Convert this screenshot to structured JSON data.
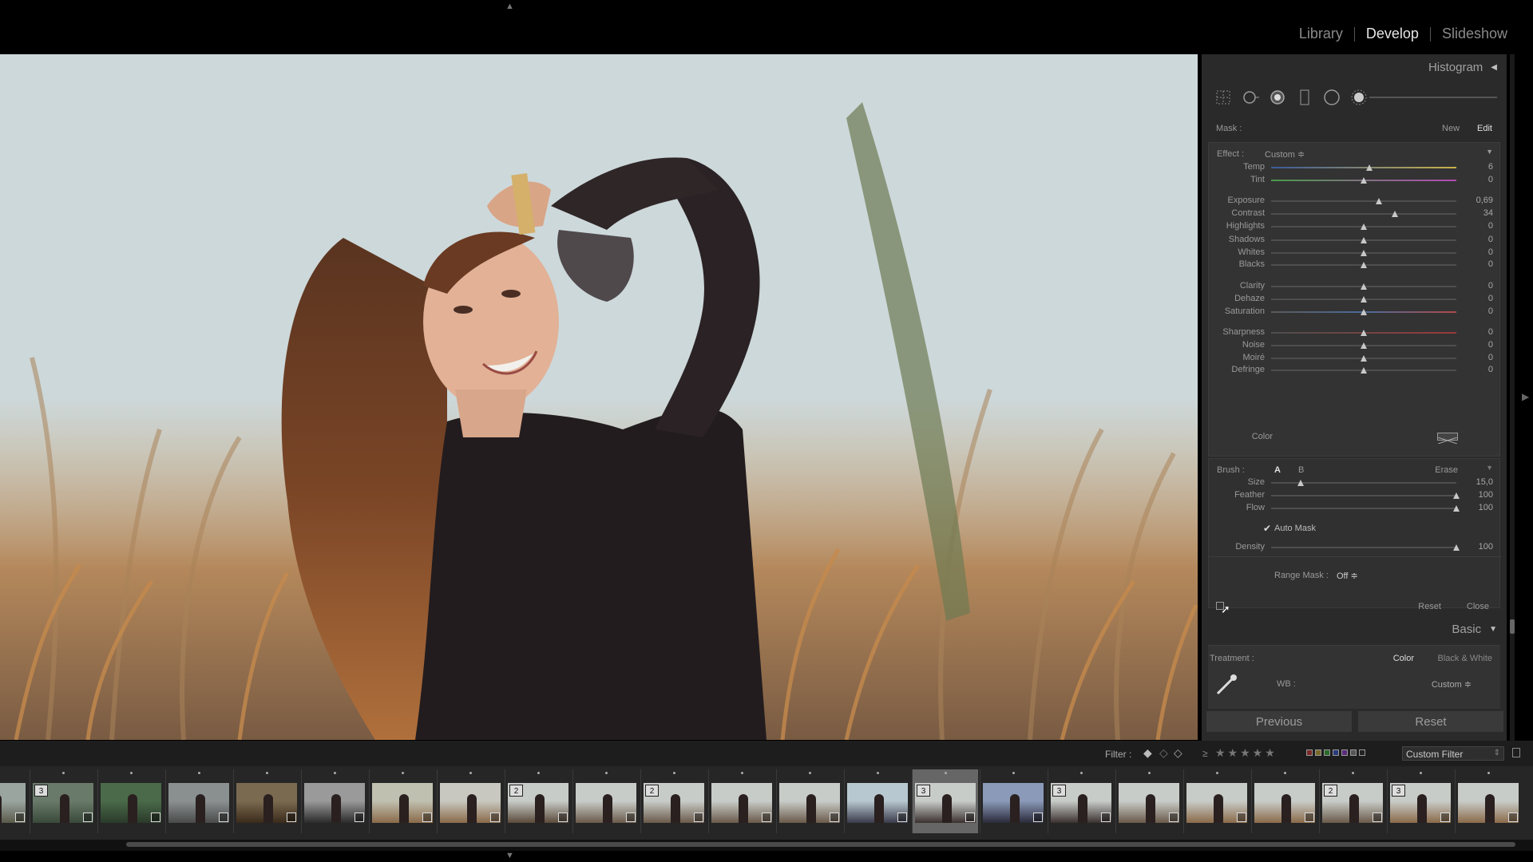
{
  "modules": [
    "Library",
    "Develop",
    "Slideshow"
  ],
  "active_module": "Develop",
  "panel": {
    "histogram_title": "Histogram",
    "mask_label": "Mask :",
    "mask_new": "New",
    "mask_edit": "Edit",
    "effect_label": "Effect :",
    "effect_value": "Custom ≑",
    "sliders": [
      {
        "label": "Temp",
        "value": "6",
        "pos": 0.53
      },
      {
        "label": "Tint",
        "value": "0",
        "pos": 0.5
      },
      {
        "label": "Exposure",
        "value": "0,69",
        "pos": 0.58
      },
      {
        "label": "Contrast",
        "value": "34",
        "pos": 0.67
      },
      {
        "label": "Highlights",
        "value": "0",
        "pos": 0.5
      },
      {
        "label": "Shadows",
        "value": "0",
        "pos": 0.5
      },
      {
        "label": "Whites",
        "value": "0",
        "pos": 0.5
      },
      {
        "label": "Blacks",
        "value": "0",
        "pos": 0.5
      },
      {
        "label": "Clarity",
        "value": "0",
        "pos": 0.5
      },
      {
        "label": "Dehaze",
        "value": "0",
        "pos": 0.5
      },
      {
        "label": "Saturation",
        "value": "0",
        "pos": 0.5
      },
      {
        "label": "Sharpness",
        "value": "0",
        "pos": 0.5
      },
      {
        "label": "Noise",
        "value": "0",
        "pos": 0.5
      },
      {
        "label": "Moiré",
        "value": "0",
        "pos": 0.5
      },
      {
        "label": "Defringe",
        "value": "0",
        "pos": 0.5
      }
    ],
    "color_label": "Color",
    "brush_label": "Brush :",
    "brush_a": "A",
    "brush_b": "B",
    "brush_erase": "Erase",
    "brush_sliders": [
      {
        "label": "Size",
        "value": "15,0",
        "pos": 0.16
      },
      {
        "label": "Feather",
        "value": "100",
        "pos": 1.0
      },
      {
        "label": "Flow",
        "value": "100",
        "pos": 1.0
      }
    ],
    "auto_mask": "Auto Mask",
    "density": {
      "label": "Density",
      "value": "100",
      "pos": 1.0
    },
    "range_mask_label": "Range Mask :",
    "range_mask_value": "Off ≑",
    "reset": "Reset",
    "close": "Close",
    "basic_title": "Basic",
    "treatment_label": "Treatment :",
    "treatment_color": "Color",
    "treatment_bw": "Black & White",
    "wb_label": "WB :",
    "wb_value": "Custom ≑",
    "previous_btn": "Previous",
    "reset_btn": "Reset"
  },
  "filmbar": {
    "filter_label": "Filter :",
    "gte": "≥",
    "custom_filter": "Custom Filter"
  },
  "filmstrip": [
    {
      "badge": ""
    },
    {
      "badge": "3"
    },
    {
      "badge": ""
    },
    {
      "badge": ""
    },
    {
      "badge": ""
    },
    {
      "badge": ""
    },
    {
      "badge": ""
    },
    {
      "badge": ""
    },
    {
      "badge": "2"
    },
    {
      "badge": ""
    },
    {
      "badge": "2"
    },
    {
      "badge": ""
    },
    {
      "badge": ""
    },
    {
      "badge": ""
    },
    {
      "badge": "3"
    },
    {
      "badge": ""
    },
    {
      "badge": "3"
    },
    {
      "badge": ""
    },
    {
      "badge": ""
    },
    {
      "badge": ""
    },
    {
      "badge": "2"
    },
    {
      "badge": "3"
    },
    {
      "badge": ""
    }
  ],
  "colors": {
    "panel_bg": "#2a2a2a",
    "accent": "#e6e6e6"
  }
}
